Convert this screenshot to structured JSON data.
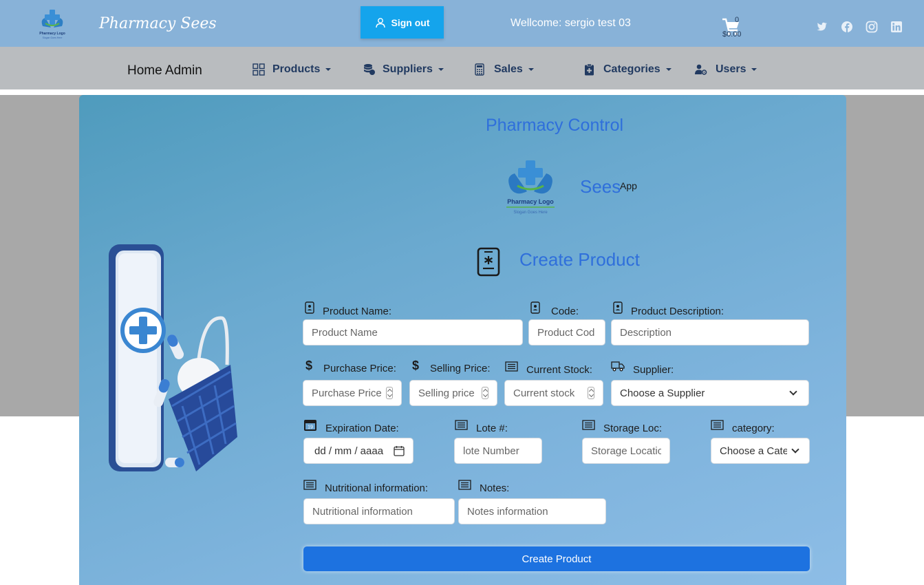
{
  "header": {
    "brand": "Pharmacy Sees",
    "signout_label": "Sign out",
    "welcome": "Wellcome: sergio test 03",
    "cart_count": "0",
    "cart_total": "$0.00",
    "logo_text": "Pharmacy Logo",
    "logo_slogan": "Slogan Goes Here"
  },
  "nav": {
    "home": "Home Admin",
    "items": [
      {
        "label": "Products",
        "icon": "grid-icon"
      },
      {
        "label": "Suppliers",
        "icon": "coins-icon"
      },
      {
        "label": "Sales",
        "icon": "calculator-icon"
      },
      {
        "label": "Categories",
        "icon": "clipboard-plus-icon"
      },
      {
        "label": "Users",
        "icon": "user-gear-icon"
      }
    ]
  },
  "main": {
    "title": "Pharmacy Control",
    "brand": "Sees",
    "brand_sup": "App",
    "logo_text": "Pharmacy Logo",
    "logo_slogan": "Slogan Goes Here",
    "form_title": "Create Product",
    "fields": {
      "name": {
        "label": "Product Name:",
        "placeholder": "Product Name"
      },
      "code": {
        "label": "Code:",
        "placeholder": "Product Cod"
      },
      "description": {
        "label": "Product Description:",
        "placeholder": "Description"
      },
      "purchase_price": {
        "label": "Purchase Price:",
        "placeholder": "Purchase Price"
      },
      "selling_price": {
        "label": "Selling Price:",
        "placeholder": "Selling price"
      },
      "current_stock": {
        "label": "Current Stock:",
        "placeholder": "Current stock"
      },
      "supplier": {
        "label": "Supplier:",
        "value": "Choose a Supplier"
      },
      "expiration": {
        "label": "Expiration Date:",
        "value": "dd / mm / aaaa"
      },
      "lote": {
        "label": "Lote #:",
        "placeholder": "lote Number"
      },
      "storage": {
        "label": "Storage Loc:",
        "placeholder": "Storage Locatio"
      },
      "category": {
        "label": "category:",
        "value": "Choose a Cate"
      },
      "nutritional": {
        "label": "Nutritional information:",
        "placeholder": "Nutritional information"
      },
      "notes": {
        "label": "Notes:",
        "placeholder": "Notes information"
      }
    },
    "submit_label": "Create Product"
  },
  "colors": {
    "header_bg": "#88b2d8",
    "signout_bg": "#14a4ec",
    "nav_bg": "#b9bcbf",
    "accent_title": "#2f6fdb",
    "submit_bg": "#1d72e0"
  }
}
